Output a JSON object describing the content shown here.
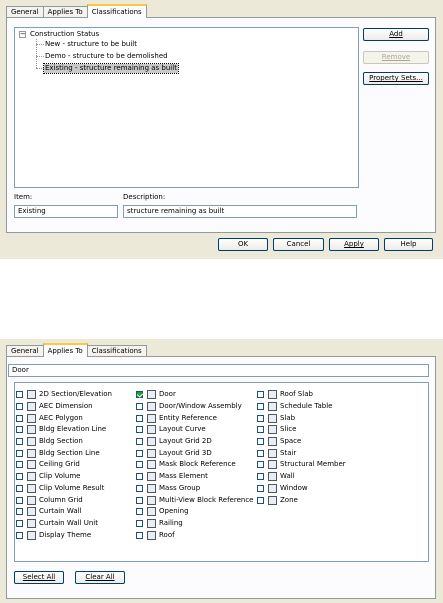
{
  "top_dialog": {
    "tabs": [
      "General",
      "Applies To",
      "Classifications"
    ],
    "active_tab": "Classifications",
    "tree": {
      "root": "Construction Status",
      "children": [
        "New - structure to be built",
        "Demo - structure to be demolished",
        "Existing - structure remaining as built"
      ],
      "selected_index": 2
    },
    "side_buttons": {
      "add": "Add",
      "remove": "Remove",
      "property_sets": "Property Sets..."
    },
    "item_label": "Item:",
    "item_value": "Existing",
    "description_label": "Description:",
    "description_value": "structure remaining as built",
    "footer_buttons": {
      "ok": "OK",
      "cancel": "Cancel",
      "apply": "Apply",
      "help": "Help"
    }
  },
  "bottom_dialog": {
    "tabs": [
      "General",
      "Applies To",
      "Classifications"
    ],
    "active_tab": "Applies To",
    "filter_value": "Door",
    "columns": [
      [
        {
          "label": "2D Section/Elevation",
          "checked": false
        },
        {
          "label": "AEC Dimension",
          "checked": false
        },
        {
          "label": "AEC Polygon",
          "checked": false
        },
        {
          "label": "Bldg Elevation Line",
          "checked": false
        },
        {
          "label": "Bldg Section",
          "checked": false
        },
        {
          "label": "Bldg Section Line",
          "checked": false
        },
        {
          "label": "Ceiling Grid",
          "checked": false
        },
        {
          "label": "Clip Volume",
          "checked": false
        },
        {
          "label": "Clip Volume Result",
          "checked": false
        },
        {
          "label": "Column Grid",
          "checked": false
        },
        {
          "label": "Curtain Wall",
          "checked": false
        },
        {
          "label": "Curtain Wall Unit",
          "checked": false
        },
        {
          "label": "Display Theme",
          "checked": false
        }
      ],
      [
        {
          "label": "Door",
          "checked": true
        },
        {
          "label": "Door/Window Assembly",
          "checked": false
        },
        {
          "label": "Entity Reference",
          "checked": false
        },
        {
          "label": "Layout Curve",
          "checked": false
        },
        {
          "label": "Layout Grid 2D",
          "checked": false
        },
        {
          "label": "Layout Grid 3D",
          "checked": false
        },
        {
          "label": "Mask Block Reference",
          "checked": false
        },
        {
          "label": "Mass Element",
          "checked": false
        },
        {
          "label": "Mass Group",
          "checked": false
        },
        {
          "label": "Multi-View Block Reference",
          "checked": false
        },
        {
          "label": "Opening",
          "checked": false
        },
        {
          "label": "Railing",
          "checked": false
        },
        {
          "label": "Roof",
          "checked": false
        }
      ],
      [
        {
          "label": "Roof Slab",
          "checked": false
        },
        {
          "label": "Schedule Table",
          "checked": false
        },
        {
          "label": "Slab",
          "checked": false
        },
        {
          "label": "Slice",
          "checked": false
        },
        {
          "label": "Space",
          "checked": false
        },
        {
          "label": "Stair",
          "checked": false
        },
        {
          "label": "Structural Member",
          "checked": false
        },
        {
          "label": "Wall",
          "checked": false
        },
        {
          "label": "Window",
          "checked": false
        },
        {
          "label": "Zone",
          "checked": false
        }
      ]
    ],
    "buttons": {
      "select_all": "Select All",
      "clear_all": "Clear All"
    }
  }
}
